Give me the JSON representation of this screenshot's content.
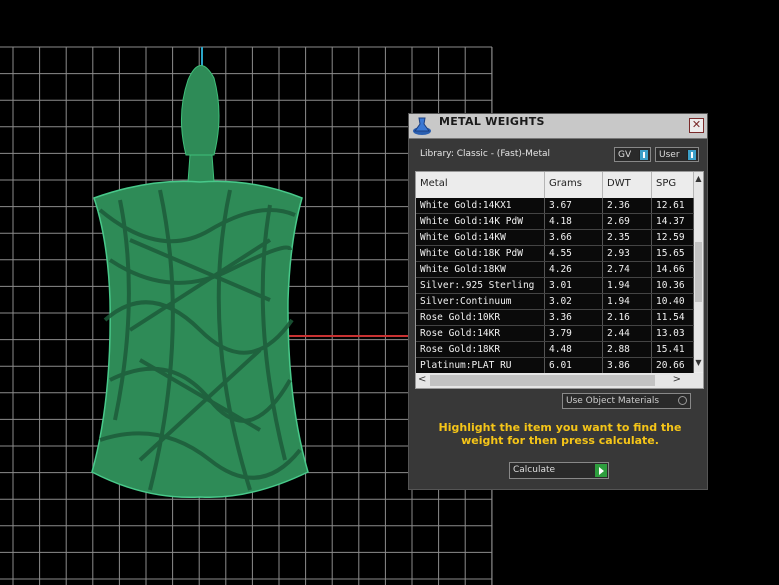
{
  "dialog": {
    "title": "METAL WEIGHTS",
    "close_label": "✕",
    "library_label": "Library: Classic - (Fast)-Metal",
    "gv_button": "GV",
    "user_button": "User",
    "columns": [
      "Metal",
      "Grams",
      "DWT",
      "SPG"
    ],
    "rows": [
      [
        "White Gold:14KX1",
        "3.67",
        "2.36",
        "12.61"
      ],
      [
        "White Gold:14K PdW",
        "4.18",
        "2.69",
        "14.37"
      ],
      [
        "White Gold:14KW",
        "3.66",
        "2.35",
        "12.59"
      ],
      [
        "White Gold:18K PdW",
        "4.55",
        "2.93",
        "15.65"
      ],
      [
        "White Gold:18KW",
        "4.26",
        "2.74",
        "14.66"
      ],
      [
        "Silver:.925 Sterling",
        "3.01",
        "1.94",
        "10.36"
      ],
      [
        "Silver:Continuum",
        "3.02",
        "1.94",
        "10.40"
      ],
      [
        "Rose Gold:10KR",
        "3.36",
        "2.16",
        "11.54"
      ],
      [
        "Rose Gold:14KR",
        "3.79",
        "2.44",
        "13.03"
      ],
      [
        "Rose Gold:18KR",
        "4.48",
        "2.88",
        "15.41"
      ],
      [
        "Platinum:PLAT RU",
        "6.01",
        "3.86",
        "20.66"
      ]
    ],
    "use_object_materials": "Use Object Materials",
    "instruction": "Highlight the item you want to find the weight for then press calculate.",
    "calculate_label": "Calculate"
  },
  "colors": {
    "background": "#000000",
    "grid": "#9a9a9a",
    "model": "#2e8b57",
    "x_axis": "#c83232",
    "y_axis": "#2aa6c8",
    "instruction_text": "#f5c518",
    "calculate_arrow": "#2e9e3e"
  }
}
